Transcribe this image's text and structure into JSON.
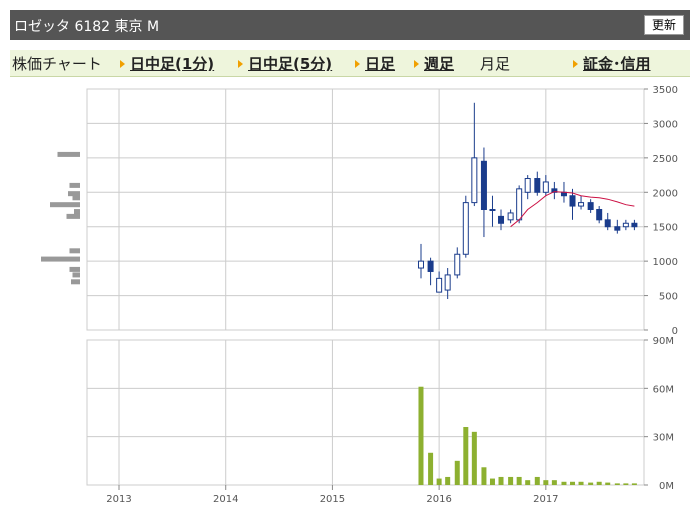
{
  "header": {
    "title": "ロゼッタ 6182 東京 M",
    "refresh_label": "更新"
  },
  "tabs": [
    {
      "label": "株価チャート",
      "link": false
    },
    {
      "label": "日中足(1分)",
      "link": true
    },
    {
      "label": "日中足(5分)",
      "link": true
    },
    {
      "label": "日足",
      "link": true
    },
    {
      "label": "週足",
      "link": true
    },
    {
      "label": "月足",
      "link": false
    },
    {
      "label": "証金･信用",
      "link": true
    }
  ],
  "colors": {
    "up": "#ffffff",
    "down": "#1a3c8c",
    "candle_outline": "#1a3c8c",
    "moving_average": "#cc1144",
    "volume_bar": "#8db030",
    "volume_profile": "#999999",
    "grid": "#cccccc"
  },
  "chart_data": [
    {
      "type": "candlestick",
      "title": "",
      "ylim": [
        0,
        3500
      ],
      "yticks": [
        "3500",
        "3000",
        "2500",
        "2000",
        "1500",
        "1000",
        "500",
        "0"
      ],
      "ytick_values": [
        3500,
        3000,
        2500,
        2000,
        1500,
        1000,
        500,
        0
      ],
      "xticks": [
        "2013",
        "2014",
        "2015",
        "2016",
        "2017"
      ],
      "xtick_values": [
        2013.0,
        2014.0,
        2015.0,
        2016.0,
        2017.0
      ],
      "xlim": [
        2012.7,
        2017.92
      ],
      "months": [
        2015.83,
        2015.92,
        2016.0,
        2016.08,
        2016.17,
        2016.25,
        2016.33,
        2016.42,
        2016.5,
        2016.58,
        2016.67,
        2016.75,
        2016.83,
        2016.92,
        2017.0,
        2017.08,
        2017.17,
        2017.25,
        2017.33,
        2017.42,
        2017.5,
        2017.58,
        2017.67,
        2017.75,
        2017.83
      ],
      "open": [
        900,
        1000,
        550,
        580,
        800,
        1100,
        1850,
        2450,
        1750,
        1650,
        1600,
        1600,
        2000,
        2200,
        2000,
        2050,
        2000,
        1950,
        1800,
        1850,
        1750,
        1600,
        1500,
        1500,
        1550
      ],
      "close": [
        1000,
        850,
        750,
        800,
        1100,
        1850,
        2500,
        1750,
        1750,
        1550,
        1700,
        2050,
        2200,
        2000,
        2150,
        2000,
        1950,
        1800,
        1850,
        1750,
        1600,
        1500,
        1450,
        1550,
        1500
      ],
      "high": [
        1250,
        1050,
        850,
        900,
        1200,
        1950,
        3300,
        2650,
        1950,
        1750,
        1750,
        2100,
        2250,
        2300,
        2250,
        2150,
        2150,
        2050,
        1950,
        1900,
        1800,
        1700,
        1600,
        1600,
        1600
      ],
      "low": [
        750,
        650,
        600,
        450,
        750,
        1050,
        1800,
        1350,
        1500,
        1450,
        1550,
        1550,
        1900,
        1950,
        1950,
        1900,
        1850,
        1600,
        1750,
        1700,
        1550,
        1450,
        1400,
        1450,
        1450
      ],
      "moving_average": {
        "x": [
          2016.67,
          2016.75,
          2016.83,
          2016.92,
          2017.0,
          2017.08,
          2017.17,
          2017.25,
          2017.33,
          2017.42,
          2017.5,
          2017.58,
          2017.67,
          2017.75,
          2017.83
        ],
        "values": [
          1500,
          1600,
          1750,
          1850,
          1950,
          2010,
          2000,
          1990,
          1950,
          1930,
          1920,
          1900,
          1860,
          1820,
          1800
        ]
      },
      "volume_profile": [
        {
          "price": 2550,
          "size": 0.75
        },
        {
          "price": 2100,
          "size": 0.35
        },
        {
          "price": 1980,
          "size": 0.4
        },
        {
          "price": 1920,
          "size": 0.25
        },
        {
          "price": 1820,
          "size": 1.0
        },
        {
          "price": 1720,
          "size": 0.2
        },
        {
          "price": 1650,
          "size": 0.45
        },
        {
          "price": 1150,
          "size": 0.35
        },
        {
          "price": 1030,
          "size": 1.3
        },
        {
          "price": 880,
          "size": 0.35
        },
        {
          "price": 800,
          "size": 0.25
        },
        {
          "price": 700,
          "size": 0.3
        }
      ]
    },
    {
      "type": "bar",
      "title": "",
      "ylim": [
        0,
        90
      ],
      "yticks": [
        "90M",
        "60M",
        "30M",
        "0M"
      ],
      "ytick_values": [
        90,
        60,
        30,
        0
      ],
      "xticks": [
        "2013",
        "2014",
        "2015",
        "2016",
        "2017"
      ],
      "x": [
        2015.83,
        2015.92,
        2016.0,
        2016.08,
        2016.17,
        2016.25,
        2016.33,
        2016.42,
        2016.5,
        2016.58,
        2016.67,
        2016.75,
        2016.83,
        2016.92,
        2017.0,
        2017.08,
        2017.17,
        2017.25,
        2017.33,
        2017.42,
        2017.5,
        2017.58,
        2017.67,
        2017.75,
        2017.83
      ],
      "values": [
        61,
        20,
        4,
        5,
        15,
        36,
        33,
        11,
        4,
        5,
        5,
        5,
        3,
        5,
        3,
        3,
        2,
        2,
        2,
        1.5,
        2,
        1.5,
        1,
        1,
        1
      ]
    }
  ]
}
